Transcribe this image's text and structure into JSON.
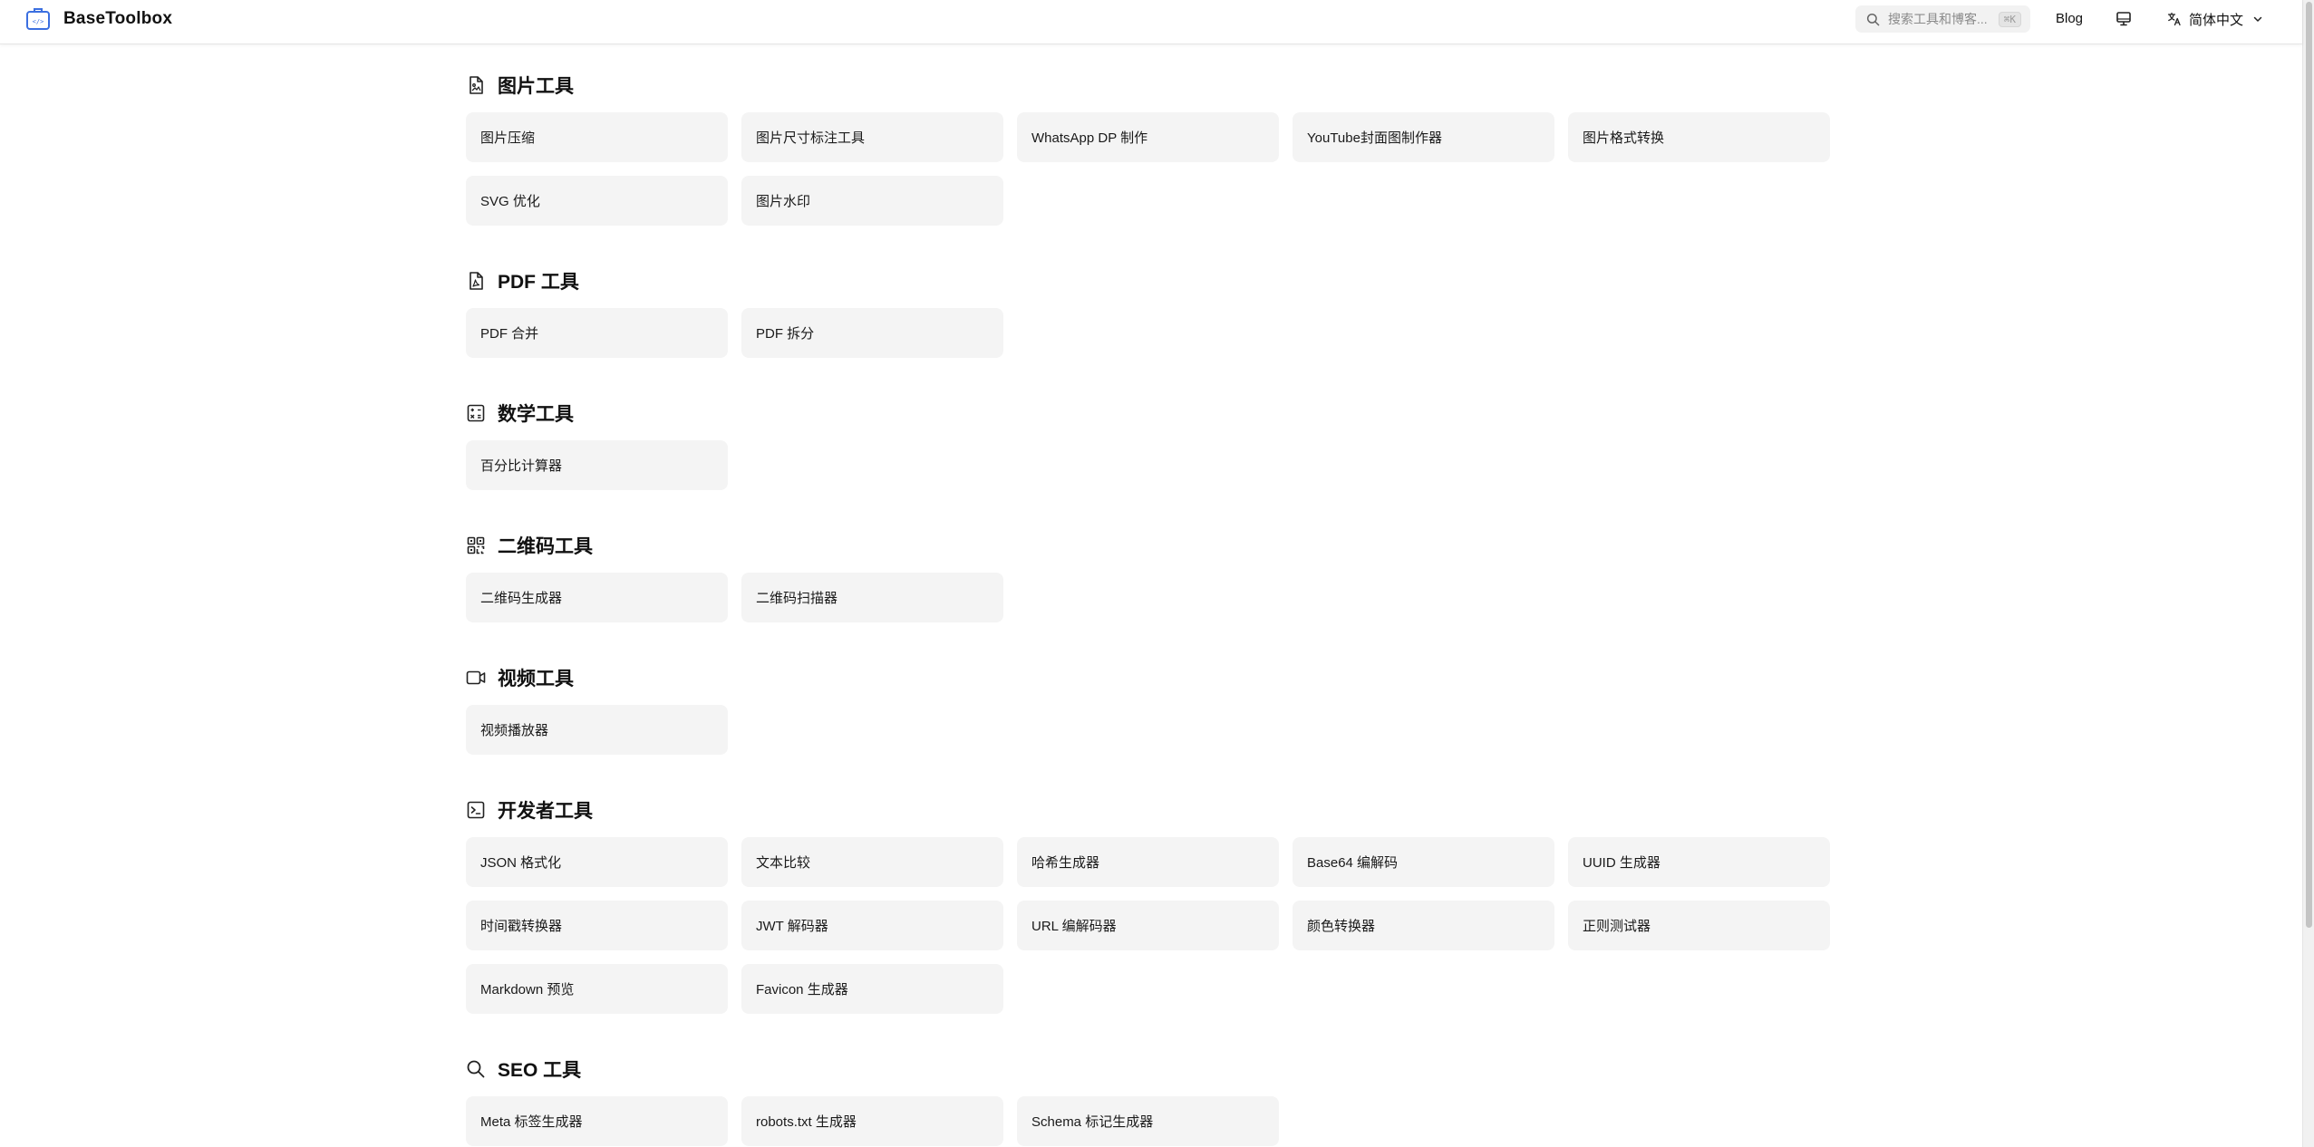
{
  "header": {
    "brand": "BaseToolbox",
    "search_placeholder": "搜索工具和博客...",
    "search_shortcut": "⌘K",
    "blog_label": "Blog",
    "language_label": "简体中文"
  },
  "sections": [
    {
      "title": "图片工具",
      "icon": "image-file-icon",
      "tools": [
        "图片压缩",
        "图片尺寸标注工具",
        "WhatsApp DP 制作",
        "YouTube封面图制作器",
        "图片格式转换",
        "SVG 优化",
        "图片水印"
      ]
    },
    {
      "title": "PDF 工具",
      "icon": "pdf-file-icon",
      "tools": [
        "PDF 合并",
        "PDF 拆分"
      ]
    },
    {
      "title": "数学工具",
      "icon": "calculator-icon",
      "tools": [
        "百分比计算器"
      ]
    },
    {
      "title": "二维码工具",
      "icon": "qr-code-icon",
      "tools": [
        "二维码生成器",
        "二维码扫描器"
      ]
    },
    {
      "title": "视频工具",
      "icon": "video-camera-icon",
      "tools": [
        "视频播放器"
      ]
    },
    {
      "title": "开发者工具",
      "icon": "terminal-icon",
      "tools": [
        "JSON 格式化",
        "文本比较",
        "哈希生成器",
        "Base64 编解码",
        "UUID 生成器",
        "时间戳转换器",
        "JWT 解码器",
        "URL 编解码器",
        "颜色转换器",
        "正则测试器",
        "Markdown 预览",
        "Favicon 生成器"
      ]
    },
    {
      "title": "SEO 工具",
      "icon": "search-icon",
      "tools": [
        "Meta 标签生成器",
        "robots.txt 生成器",
        "Schema 标记生成器"
      ]
    }
  ]
}
